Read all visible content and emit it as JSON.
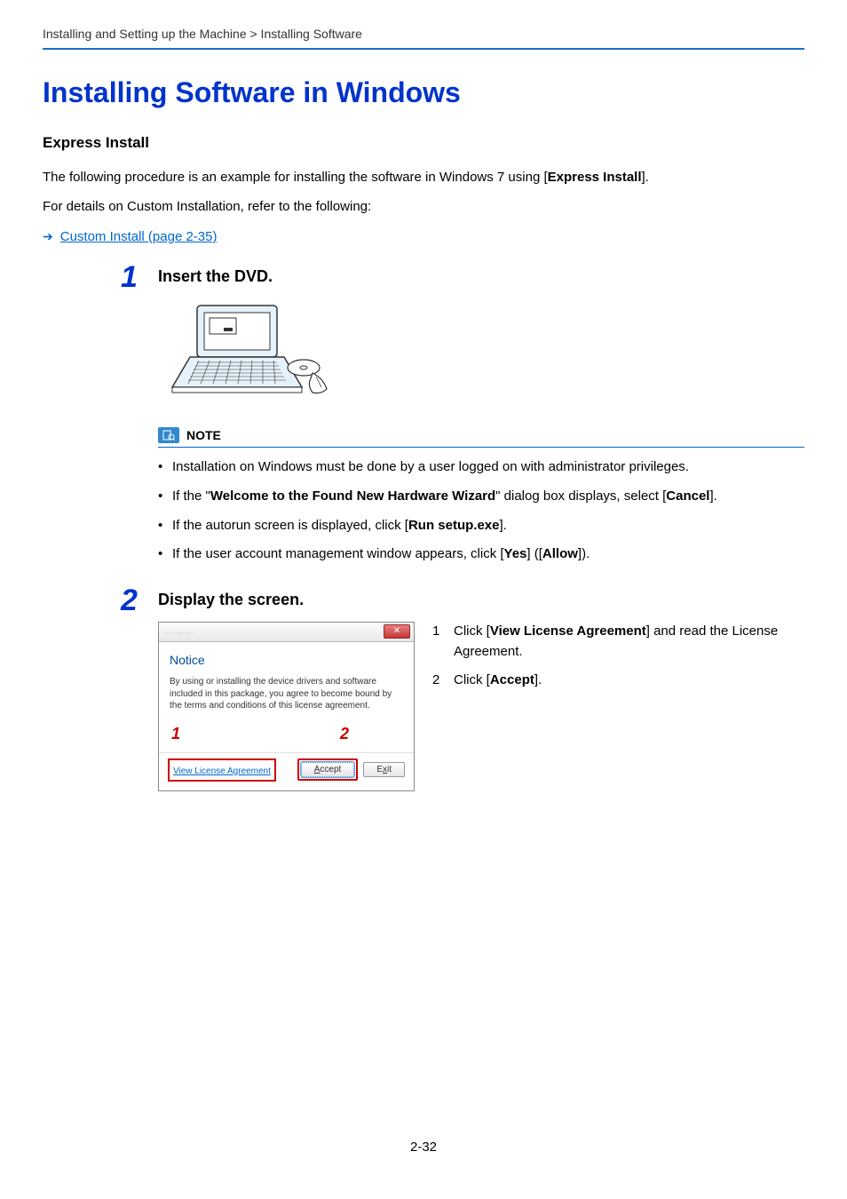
{
  "breadcrumb": "Installing and Setting up the Machine > Installing Software",
  "h1": "Installing Software in Windows",
  "h2": "Express Install",
  "intro_line1_pre": "The following procedure is an example for installing the software in Windows 7 using [",
  "intro_line1_bold": "Express Install",
  "intro_line1_post": "].",
  "intro_line2": "For details on Custom Installation, refer to the following:",
  "link_text": "Custom Install (page 2-35)",
  "step1": {
    "num": "1",
    "title": "Insert the DVD."
  },
  "note": {
    "label": "NOTE",
    "items": {
      "i1": "Installation on Windows must be done by a user logged on with administrator privileges.",
      "i2_pre": "If the \"",
      "i2_b1": "Welcome to the Found New Hardware Wizard",
      "i2_mid": "\" dialog box displays, select [",
      "i2_b2": "Cancel",
      "i2_post": "].",
      "i3_pre": "If the autorun screen is displayed, click [",
      "i3_b": "Run setup.exe",
      "i3_post": "].",
      "i4_pre": "If the user account management window appears, click [",
      "i4_b1": "Yes",
      "i4_mid": "] ([",
      "i4_b2": "Allow",
      "i4_post": "])."
    }
  },
  "step2": {
    "num": "2",
    "title": "Display the screen."
  },
  "dialog": {
    "notice": "Notice",
    "text": "By using or installing the device drivers and software included in this package, you agree to become bound by the terms and conditions of this license agreement.",
    "marker1": "1",
    "marker2": "2",
    "vla": "View License Agreement",
    "accept": "Accept",
    "exit": "Exit",
    "close": "✕"
  },
  "instructions": {
    "r1_num": "1",
    "r1_pre": "Click [",
    "r1_b": "View License Agreement",
    "r1_post": "] and read the License Agreement.",
    "r2_num": "2",
    "r2_pre": "Click [",
    "r2_b": "Accept",
    "r2_post": "]."
  },
  "page_number": "2-32"
}
